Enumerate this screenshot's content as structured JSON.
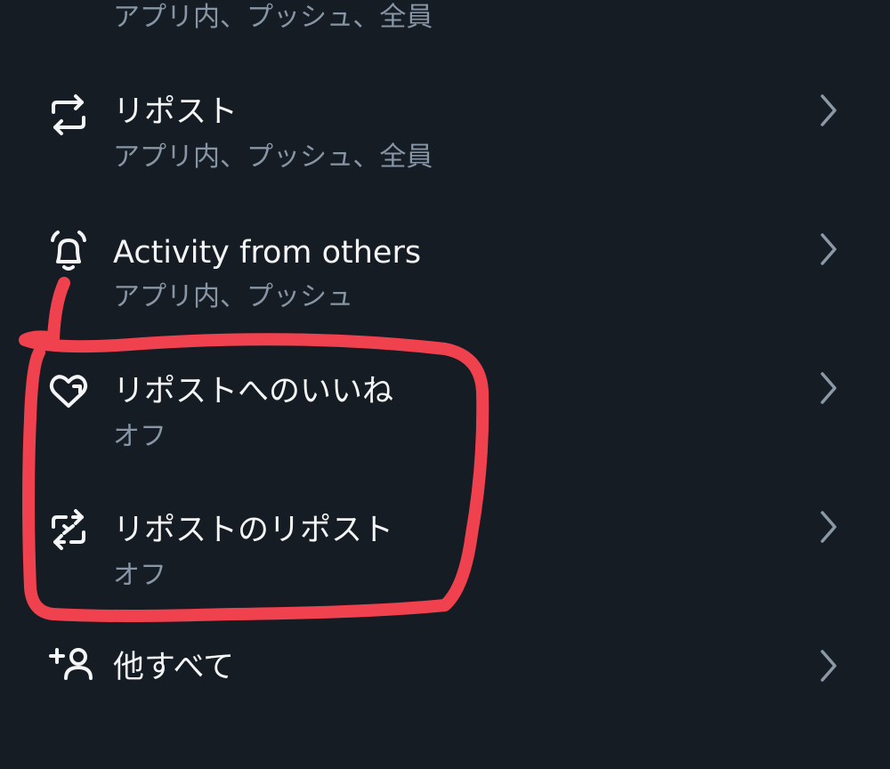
{
  "rows": [
    {
      "icon": "partial-row-top",
      "title": "",
      "subtitle": "アプリ内、プッシュ、全員"
    },
    {
      "icon": "repost-icon",
      "title": "リポスト",
      "subtitle": "アプリ内、プッシュ、全員"
    },
    {
      "icon": "bell-ringing-icon",
      "title": "Activity from others",
      "subtitle": "アプリ内、プッシュ"
    },
    {
      "icon": "heart-repost-icon",
      "title": "リポストへのいいね",
      "subtitle": "オフ"
    },
    {
      "icon": "repost-of-repost-icon",
      "title": "リポストのリポスト",
      "subtitle": "オフ"
    },
    {
      "icon": "person-plus-icon",
      "title": "他すべて",
      "subtitle": ""
    }
  ],
  "colors": {
    "background": "#161c23",
    "title": "#f4f5f6",
    "subtitle": "#8696a6",
    "chevron": "#8a98a7",
    "annotation": "#f0414f"
  }
}
